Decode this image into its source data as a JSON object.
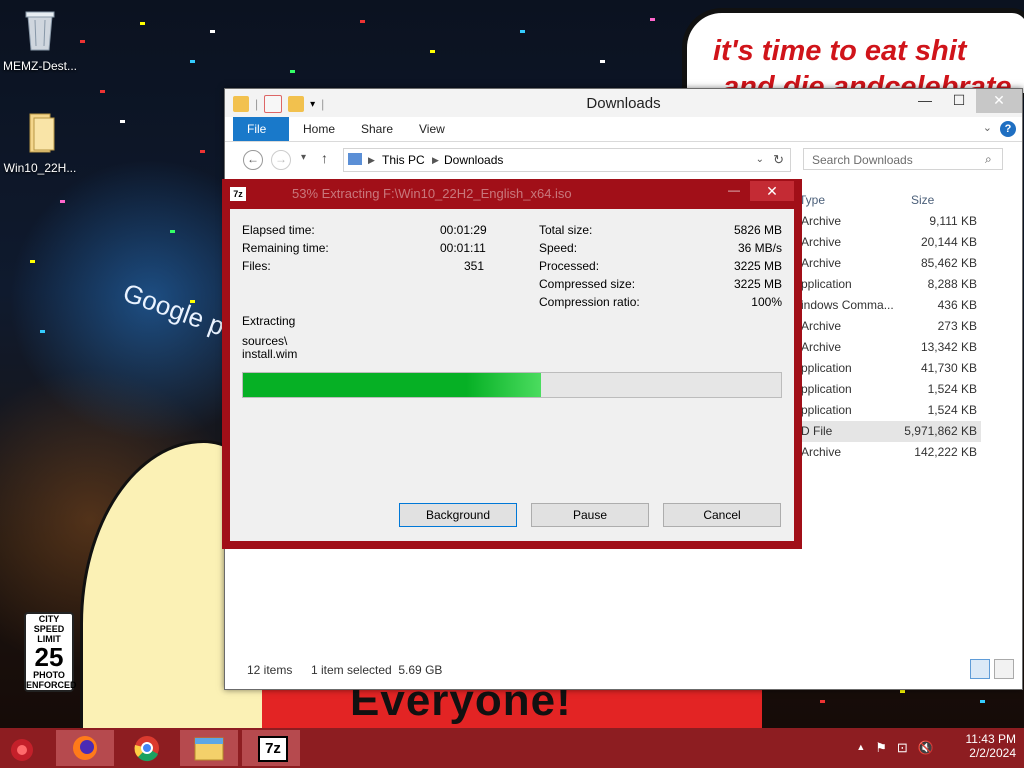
{
  "desktop": {
    "icons": [
      {
        "label": "MEMZ-Dest..."
      },
      {
        "label": "Win10_22H..."
      }
    ],
    "bubble_line1": "it's time to eat shit",
    "bubble_line2": "and die andcelebrate",
    "banner_text": "Everyone!",
    "billboard_text": "Google play",
    "sign": {
      "line1": "CITY",
      "line2": "SPEED",
      "line3": "LIMIT",
      "number": "25",
      "line4": "PHOTO",
      "line5": "ENFORCED"
    }
  },
  "explorer": {
    "title": "Downloads",
    "tabs": [
      "File",
      "Home",
      "Share",
      "View"
    ],
    "breadcrumb": [
      "This PC",
      "Downloads"
    ],
    "search_placeholder": "Search Downloads",
    "columns": {
      "type": "Type",
      "size": "Size"
    },
    "rows": [
      {
        "type": "Archive",
        "size": "9,111 KB"
      },
      {
        "type": "Archive",
        "size": "20,144 KB"
      },
      {
        "type": "Archive",
        "size": "85,462 KB"
      },
      {
        "type": "pplication",
        "size": "8,288 KB"
      },
      {
        "type": "indows Comma...",
        "size": "436 KB"
      },
      {
        "type": "Archive",
        "size": "273 KB"
      },
      {
        "type": "Archive",
        "size": "13,342 KB"
      },
      {
        "type": "pplication",
        "size": "41,730 KB"
      },
      {
        "type": "pplication",
        "size": "1,524 KB"
      },
      {
        "type": "pplication",
        "size": "1,524 KB"
      },
      {
        "type": "D File",
        "size": "5,971,862 KB"
      },
      {
        "type": "Archive",
        "size": "142,222 KB"
      }
    ],
    "status": {
      "items": "12 items",
      "selected": "1 item selected  5.69 GB"
    }
  },
  "dialog": {
    "logo": "7z",
    "title": "53% Extracting F:\\Win10_22H2_English_x64.iso",
    "left": {
      "elapsed_label": "Elapsed time:",
      "elapsed": "00:01:29",
      "remaining_label": "Remaining time:",
      "remaining": "00:01:11",
      "files_label": "Files:",
      "files": "351"
    },
    "right": {
      "total_label": "Total size:",
      "total": "5826 MB",
      "speed_label": "Speed:",
      "speed": "36 MB/s",
      "processed_label": "Processed:",
      "processed": "3225 MB",
      "compressed_label": "Compressed size:",
      "compressed": "3225 MB",
      "ratio_label": "Compression ratio:",
      "ratio": "100%"
    },
    "action": "Extracting",
    "path1": "sources\\",
    "path2": "install.wim",
    "progress": 0.553,
    "buttons": {
      "background": "Background",
      "pause": "Pause",
      "cancel": "Cancel"
    }
  },
  "taskbar": {
    "time": "11:43 PM",
    "date": "2/2/2024",
    "seven_zip_label": "7z"
  }
}
